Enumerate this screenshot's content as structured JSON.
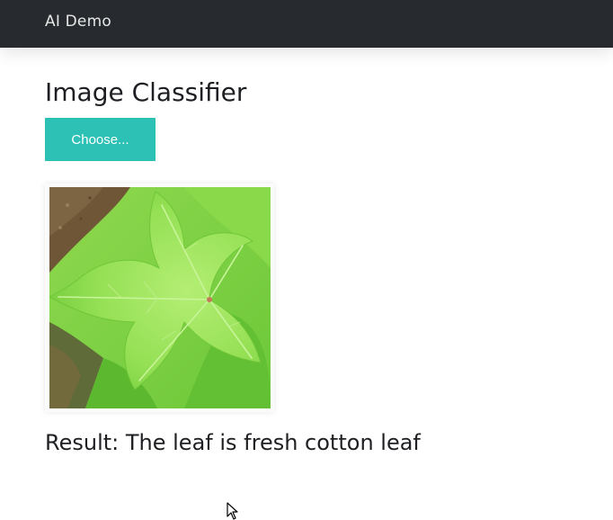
{
  "navbar": {
    "brand": "AI Demo"
  },
  "main": {
    "title": "Image Classifier",
    "choose_button_label": "Choose...",
    "preview_image": {
      "subject": "green cotton leaf"
    },
    "result_text": "Result: The leaf is fresh cotton leaf"
  },
  "colors": {
    "navbar_bg": "#272a2e",
    "button_bg": "#2dc1b5",
    "text": "#1d1f22"
  }
}
